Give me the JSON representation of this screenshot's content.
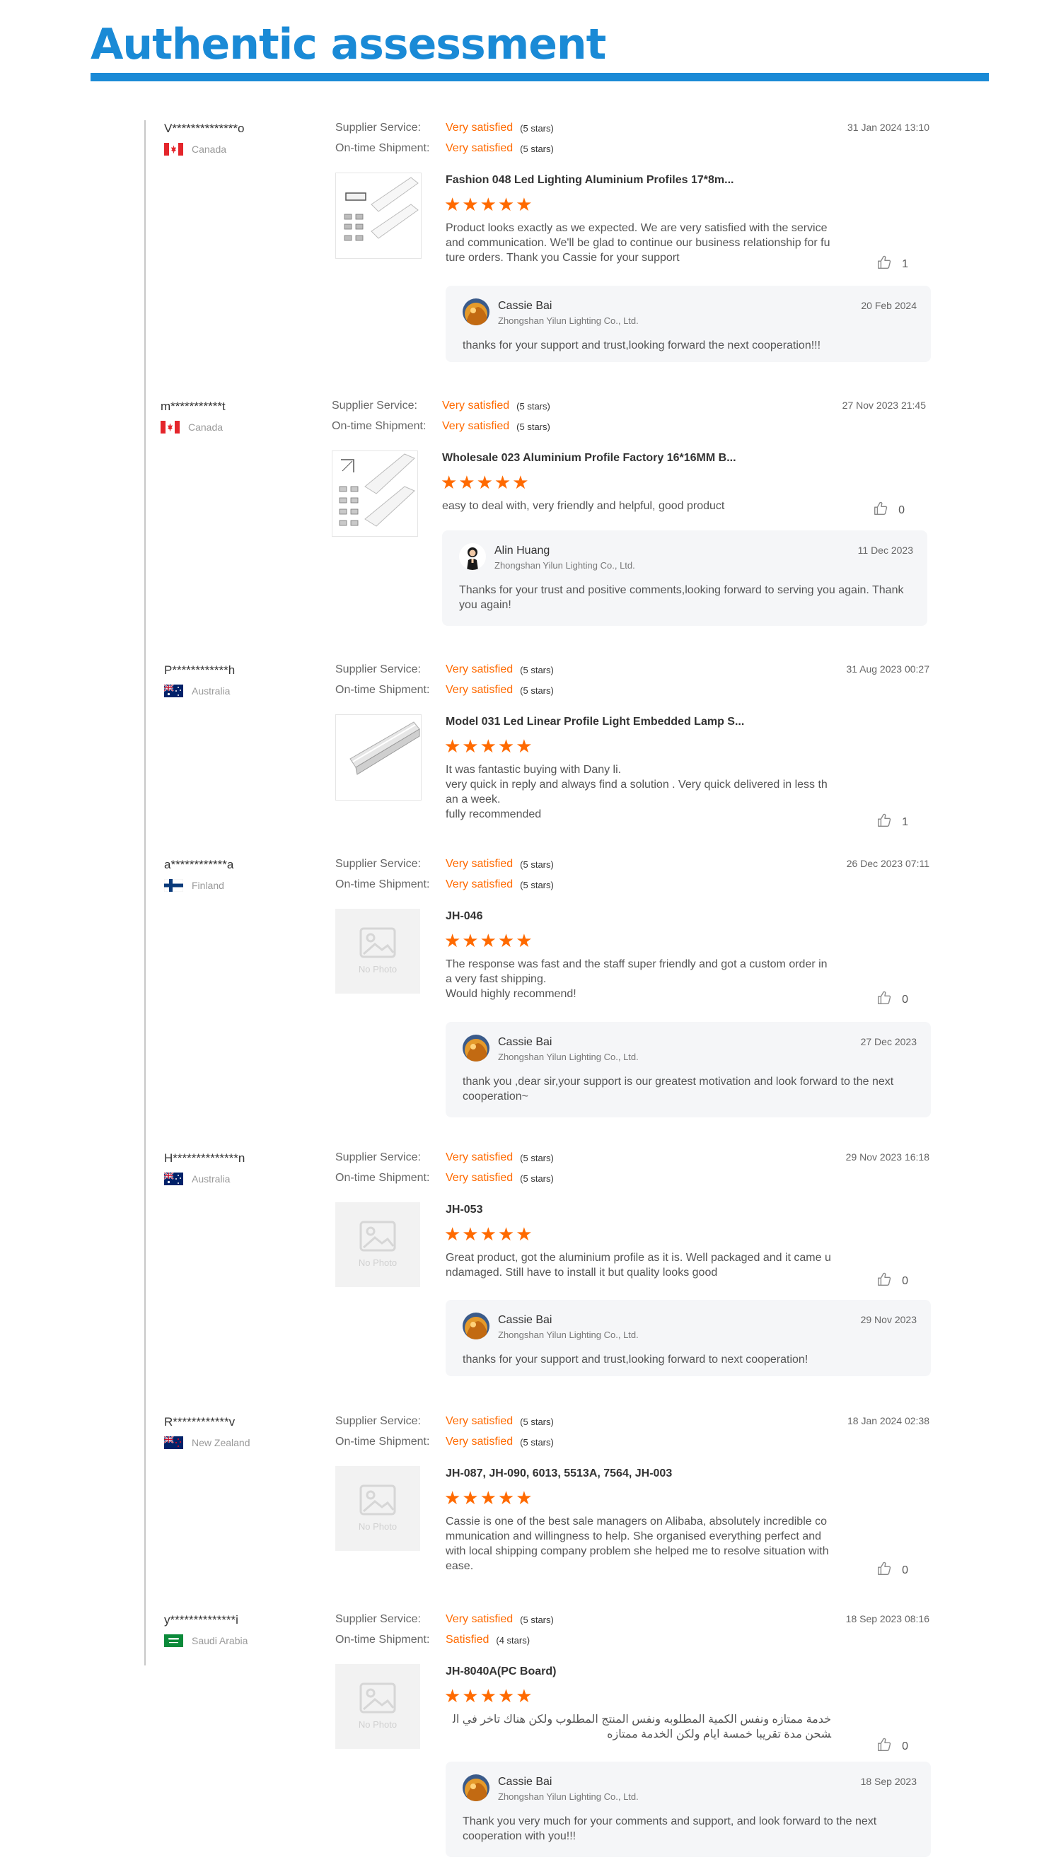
{
  "page": {
    "title": "Authentic assessment"
  },
  "labels": {
    "supplier_service": "Supplier Service:",
    "on_time_shipment": "On-time Shipment:",
    "no_photo": "No Photo"
  },
  "colors": {
    "accent_blue": "#1a8ad6",
    "rating_orange": "#ff6a00"
  },
  "reviews": [
    {
      "buyer": "V**************o",
      "country": "Canada",
      "flag": "canada-flag-icon",
      "date": "31 Jan 2024 13:10",
      "supplier_service": {
        "value": "Very satisfied",
        "stars": "(5 stars)"
      },
      "on_time_shipment": {
        "value": "Very satisfied",
        "stars": "(5 stars)"
      },
      "product": "Fashion 048 Led Lighting Aluminium Profiles 17*8m...",
      "thumbnail": "aluminium-profile-kit-image",
      "rating": 5,
      "rating_stars": "★★★★★",
      "comment": "Product looks exactly as we expected. We are very satisfied with the service and communication. We'll be glad to continue our business relationship for future orders. Thank you Cassie for your support",
      "likes": "1",
      "reply": {
        "name": "Cassie Bai",
        "company": "Zhongshan Yilun Lighting Co., Ltd.",
        "date": "20 Feb 2024",
        "text": "thanks for your support and trust,looking forward the next cooperation!!!"
      }
    },
    {
      "buyer": "m***********t",
      "country": "Canada",
      "flag": "canada-flag-icon",
      "date": "27 Nov 2023 21:45",
      "supplier_service": {
        "value": "Very satisfied",
        "stars": "(5 stars)"
      },
      "on_time_shipment": {
        "value": "Very satisfied",
        "stars": "(5 stars)"
      },
      "product": "Wholesale 023 Aluminium Profile Factory 16*16MM B...",
      "thumbnail": "corner-profile-kit-image",
      "rating": 5,
      "rating_stars": "★★★★★",
      "comment": "easy to deal with,  very friendly and helpful, good product",
      "likes": "0",
      "reply": {
        "name": "Alin Huang",
        "company": "Zhongshan Yilun Lighting Co., Ltd.",
        "date": "11 Dec 2023",
        "text": "Thanks for your trust and positive comments,looking forward to serving you again. Thank you again!"
      }
    },
    {
      "buyer": "P************h",
      "country": "Australia",
      "flag": "australia-flag-icon",
      "date": "31 Aug 2023 00:27",
      "supplier_service": {
        "value": "Very satisfied",
        "stars": "(5 stars)"
      },
      "on_time_shipment": {
        "value": "Very satisfied",
        "stars": "(5 stars)"
      },
      "product": "Model 031 Led Linear Profile Light Embedded Lamp S...",
      "thumbnail": "linear-profile-image",
      "rating": 5,
      "rating_stars": "★★★★★",
      "comment": "It was fantastic buying with  Dany li.\nvery quick in reply and always find a solution . Very  quick delivered in less than a week.\nfully recommended",
      "likes": "1"
    },
    {
      "buyer": "a************a",
      "country": "Finland",
      "flag": "finland-flag-icon",
      "date": "26 Dec 2023 07:11",
      "supplier_service": {
        "value": "Very satisfied",
        "stars": "(5 stars)"
      },
      "on_time_shipment": {
        "value": "Very satisfied",
        "stars": "(5 stars)"
      },
      "product": "JH-046",
      "thumbnail": "no-photo-placeholder",
      "rating": 5,
      "rating_stars": "★★★★★",
      "comment": "The response was fast and the staff super friendly and got a custom order in a very fast shipping.\nWould highly recommend!",
      "likes": "0",
      "reply": {
        "name": "Cassie Bai",
        "company": "Zhongshan Yilun Lighting Co., Ltd.",
        "date": "27 Dec 2023",
        "text": "thank you ,dear sir,your support is our greatest motivation and look forward to the next cooperation~"
      }
    },
    {
      "buyer": "H**************n",
      "country": "Australia",
      "flag": "australia-flag-icon",
      "date": "29 Nov 2023 16:18",
      "supplier_service": {
        "value": "Very satisfied",
        "stars": "(5 stars)"
      },
      "on_time_shipment": {
        "value": "Very satisfied",
        "stars": "(5 stars)"
      },
      "product": "JH-053",
      "thumbnail": "no-photo-placeholder",
      "rating": 5,
      "rating_stars": "★★★★★",
      "comment": "Great product, got the aluminium profile as it is. Well packaged and it came undamaged. Still have to install it but quality looks good",
      "likes": "0",
      "reply": {
        "name": "Cassie Bai",
        "company": "Zhongshan Yilun Lighting Co., Ltd.",
        "date": "29 Nov 2023",
        "text": "thanks for your support and trust,looking forward to next cooperation!"
      }
    },
    {
      "buyer": "R************v",
      "country": "New Zealand",
      "flag": "new-zealand-flag-icon",
      "date": "18 Jan 2024 02:38",
      "supplier_service": {
        "value": "Very satisfied",
        "stars": "(5 stars)"
      },
      "on_time_shipment": {
        "value": "Very satisfied",
        "stars": "(5 stars)"
      },
      "product": "JH-087, JH-090, 6013, 5513A, 7564, JH-003",
      "thumbnail": "no-photo-placeholder",
      "rating": 5,
      "rating_stars": "★★★★★",
      "comment": "Cassie is one of the best sale managers on Alibaba, absolutely incredible communication and willingness to help. She organised everything perfect and with local shipping company problem she helped me to resolve situation with ease.",
      "likes": "0"
    },
    {
      "buyer": "y**************i",
      "country": "Saudi Arabia",
      "flag": "saudi-arabia-flag-icon",
      "date": "18 Sep 2023 08:16",
      "supplier_service": {
        "value": "Very satisfied",
        "stars": "(5 stars)"
      },
      "on_time_shipment": {
        "value": "Satisfied",
        "stars": "(4 stars)"
      },
      "product": "JH-8040A(PC Board)",
      "thumbnail": "no-photo-placeholder",
      "rating": 5,
      "rating_stars": "★★★★★",
      "comment": "خدمة ممتازه ونفس الكمية المطلوبه ونفس المنتج المطلوب ولكن هناك تاخر في الشحن مدة تقريبا خمسة ايام ولكن الخدمة ممتازه",
      "likes": "0",
      "reply": {
        "name": "Cassie Bai",
        "company": "Zhongshan Yilun Lighting Co., Ltd.",
        "date": "18 Sep 2023",
        "text": "Thank you very much for your comments and support, and look forward to the next cooperation with you!!!"
      }
    }
  ]
}
